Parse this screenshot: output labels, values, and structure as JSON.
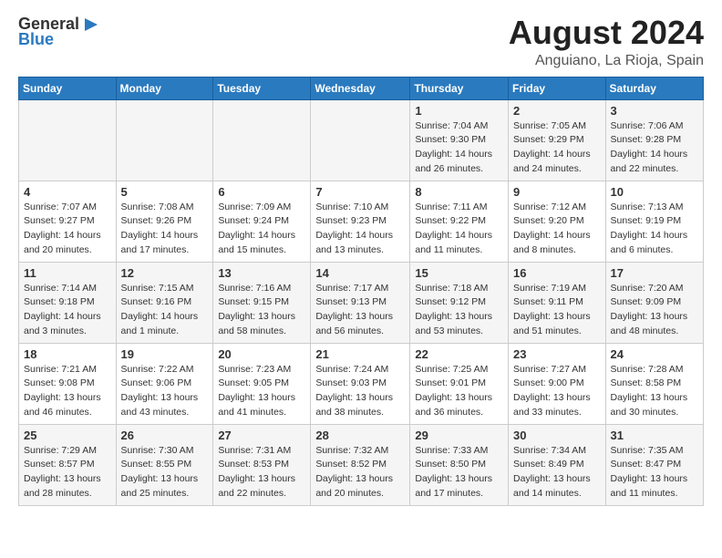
{
  "logo": {
    "general": "General",
    "blue": "Blue"
  },
  "title": {
    "month_year": "August 2024",
    "location": "Anguiano, La Rioja, Spain"
  },
  "weekdays": [
    "Sunday",
    "Monday",
    "Tuesday",
    "Wednesday",
    "Thursday",
    "Friday",
    "Saturday"
  ],
  "weeks": [
    [
      {
        "day": "",
        "info": ""
      },
      {
        "day": "",
        "info": ""
      },
      {
        "day": "",
        "info": ""
      },
      {
        "day": "",
        "info": ""
      },
      {
        "day": "1",
        "info": "Sunrise: 7:04 AM\nSunset: 9:30 PM\nDaylight: 14 hours and 26 minutes."
      },
      {
        "day": "2",
        "info": "Sunrise: 7:05 AM\nSunset: 9:29 PM\nDaylight: 14 hours and 24 minutes."
      },
      {
        "day": "3",
        "info": "Sunrise: 7:06 AM\nSunset: 9:28 PM\nDaylight: 14 hours and 22 minutes."
      }
    ],
    [
      {
        "day": "4",
        "info": "Sunrise: 7:07 AM\nSunset: 9:27 PM\nDaylight: 14 hours and 20 minutes."
      },
      {
        "day": "5",
        "info": "Sunrise: 7:08 AM\nSunset: 9:26 PM\nDaylight: 14 hours and 17 minutes."
      },
      {
        "day": "6",
        "info": "Sunrise: 7:09 AM\nSunset: 9:24 PM\nDaylight: 14 hours and 15 minutes."
      },
      {
        "day": "7",
        "info": "Sunrise: 7:10 AM\nSunset: 9:23 PM\nDaylight: 14 hours and 13 minutes."
      },
      {
        "day": "8",
        "info": "Sunrise: 7:11 AM\nSunset: 9:22 PM\nDaylight: 14 hours and 11 minutes."
      },
      {
        "day": "9",
        "info": "Sunrise: 7:12 AM\nSunset: 9:20 PM\nDaylight: 14 hours and 8 minutes."
      },
      {
        "day": "10",
        "info": "Sunrise: 7:13 AM\nSunset: 9:19 PM\nDaylight: 14 hours and 6 minutes."
      }
    ],
    [
      {
        "day": "11",
        "info": "Sunrise: 7:14 AM\nSunset: 9:18 PM\nDaylight: 14 hours and 3 minutes."
      },
      {
        "day": "12",
        "info": "Sunrise: 7:15 AM\nSunset: 9:16 PM\nDaylight: 14 hours and 1 minute."
      },
      {
        "day": "13",
        "info": "Sunrise: 7:16 AM\nSunset: 9:15 PM\nDaylight: 13 hours and 58 minutes."
      },
      {
        "day": "14",
        "info": "Sunrise: 7:17 AM\nSunset: 9:13 PM\nDaylight: 13 hours and 56 minutes."
      },
      {
        "day": "15",
        "info": "Sunrise: 7:18 AM\nSunset: 9:12 PM\nDaylight: 13 hours and 53 minutes."
      },
      {
        "day": "16",
        "info": "Sunrise: 7:19 AM\nSunset: 9:11 PM\nDaylight: 13 hours and 51 minutes."
      },
      {
        "day": "17",
        "info": "Sunrise: 7:20 AM\nSunset: 9:09 PM\nDaylight: 13 hours and 48 minutes."
      }
    ],
    [
      {
        "day": "18",
        "info": "Sunrise: 7:21 AM\nSunset: 9:08 PM\nDaylight: 13 hours and 46 minutes."
      },
      {
        "day": "19",
        "info": "Sunrise: 7:22 AM\nSunset: 9:06 PM\nDaylight: 13 hours and 43 minutes."
      },
      {
        "day": "20",
        "info": "Sunrise: 7:23 AM\nSunset: 9:05 PM\nDaylight: 13 hours and 41 minutes."
      },
      {
        "day": "21",
        "info": "Sunrise: 7:24 AM\nSunset: 9:03 PM\nDaylight: 13 hours and 38 minutes."
      },
      {
        "day": "22",
        "info": "Sunrise: 7:25 AM\nSunset: 9:01 PM\nDaylight: 13 hours and 36 minutes."
      },
      {
        "day": "23",
        "info": "Sunrise: 7:27 AM\nSunset: 9:00 PM\nDaylight: 13 hours and 33 minutes."
      },
      {
        "day": "24",
        "info": "Sunrise: 7:28 AM\nSunset: 8:58 PM\nDaylight: 13 hours and 30 minutes."
      }
    ],
    [
      {
        "day": "25",
        "info": "Sunrise: 7:29 AM\nSunset: 8:57 PM\nDaylight: 13 hours and 28 minutes."
      },
      {
        "day": "26",
        "info": "Sunrise: 7:30 AM\nSunset: 8:55 PM\nDaylight: 13 hours and 25 minutes."
      },
      {
        "day": "27",
        "info": "Sunrise: 7:31 AM\nSunset: 8:53 PM\nDaylight: 13 hours and 22 minutes."
      },
      {
        "day": "28",
        "info": "Sunrise: 7:32 AM\nSunset: 8:52 PM\nDaylight: 13 hours and 20 minutes."
      },
      {
        "day": "29",
        "info": "Sunrise: 7:33 AM\nSunset: 8:50 PM\nDaylight: 13 hours and 17 minutes."
      },
      {
        "day": "30",
        "info": "Sunrise: 7:34 AM\nSunset: 8:49 PM\nDaylight: 13 hours and 14 minutes."
      },
      {
        "day": "31",
        "info": "Sunrise: 7:35 AM\nSunset: 8:47 PM\nDaylight: 13 hours and 11 minutes."
      }
    ]
  ]
}
